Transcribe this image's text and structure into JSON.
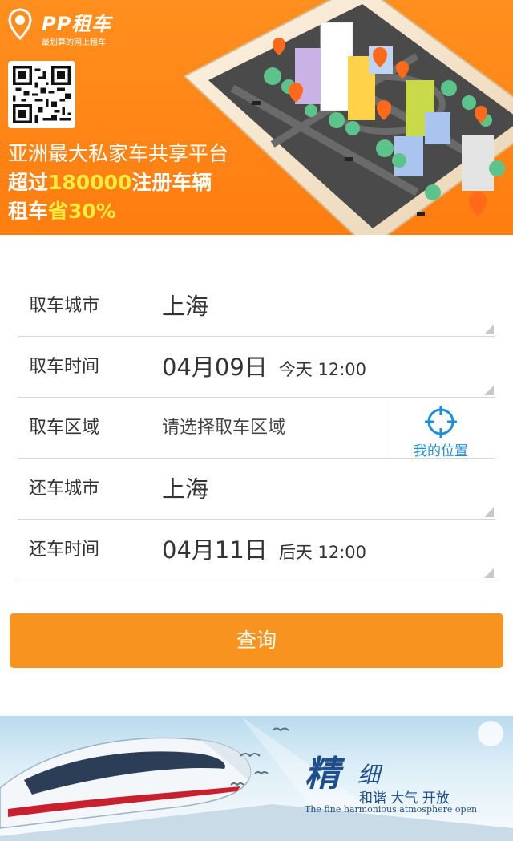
{
  "banner": {
    "logo_title": "PP租车",
    "logo_subtitle": "最划算的网上租车",
    "tagline_1": "亚洲最大私家车共享平台",
    "tagline_2_prefix": "超过",
    "tagline_2_highlight": "180000",
    "tagline_2_suffix": "注册车辆",
    "tagline_3_prefix": "租车",
    "tagline_3_highlight": "省30%",
    "highlight_color": "#ffec3d",
    "background_color": "#ff8a1a"
  },
  "form": {
    "pickup_city": {
      "label": "取车城市",
      "value": "上海"
    },
    "pickup_time": {
      "label": "取车时间",
      "value": "04月09日",
      "extra": "今天 12:00"
    },
    "pickup_area": {
      "label": "取车区域",
      "placeholder": "请选择取车区域",
      "locate_label": "我的位置",
      "locate_icon": "crosshair-icon"
    },
    "return_city": {
      "label": "还车城市",
      "value": "上海"
    },
    "return_time": {
      "label": "还车时间",
      "value": "04月11日",
      "extra": "后天 12:00"
    }
  },
  "query_button": {
    "label": "查询",
    "color": "#f7931e"
  },
  "bottom_banner": {
    "slogan_jing": "精",
    "slogan_xi": "细",
    "slogan_cn": "和谐  大气  开放",
    "slogan_en": "The fine harmonious atmosphere open"
  },
  "accent_blue": "#1b8fd8"
}
